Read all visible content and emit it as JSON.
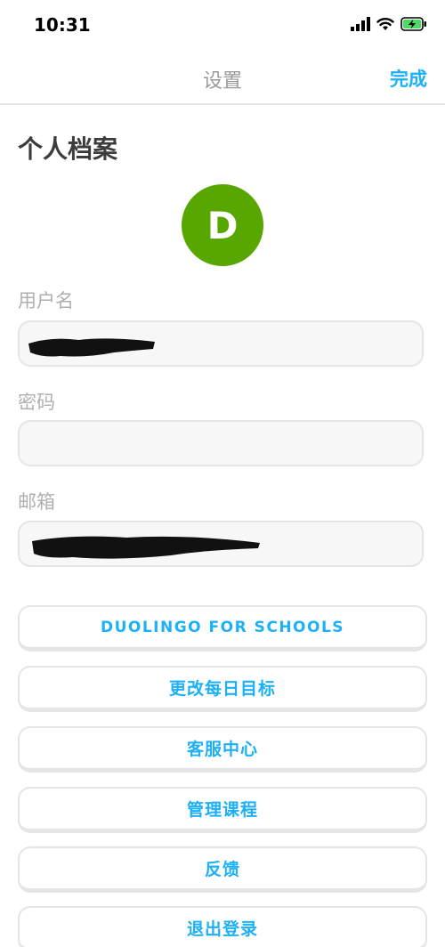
{
  "status_bar": {
    "time": "10:31",
    "icons": [
      "cellular-signal-icon",
      "wifi-icon",
      "battery-charging-icon"
    ],
    "battery_color": "#4cd964"
  },
  "nav": {
    "title": "设置",
    "done_label": "完成"
  },
  "profile": {
    "section_title": "个人档案",
    "avatar_letter": "D",
    "avatar_color": "#58a700"
  },
  "fields": {
    "username": {
      "label": "用户名",
      "value": "",
      "redacted": true
    },
    "password": {
      "label": "密码",
      "value": ""
    },
    "email": {
      "label": "邮箱",
      "value": "",
      "redacted": true
    }
  },
  "buttons": {
    "schools": "DUOLINGO FOR SCHOOLS",
    "daily_goal": "更改每日目标",
    "help_center": "客服中心",
    "manage_courses": "管理课程",
    "feedback": "反馈",
    "logout": "退出登录"
  },
  "colors": {
    "accent": "#1cb0f6",
    "field_bg": "#f7f7f7",
    "border": "#e5e5e5",
    "label": "#afafaf"
  }
}
